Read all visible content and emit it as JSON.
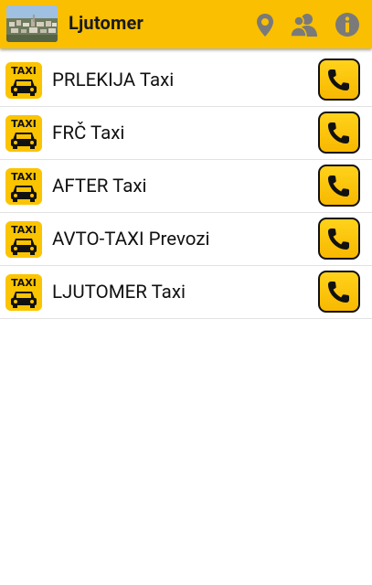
{
  "header": {
    "title": "Ljutomer",
    "thumbnail_icon": "town-photo",
    "actions": [
      {
        "icon": "location-pin-icon"
      },
      {
        "icon": "contacts-icon"
      },
      {
        "icon": "info-icon"
      }
    ],
    "accent_color": "#f9bf00"
  },
  "taxis": [
    {
      "name": "PRLEKIJA Taxi",
      "icon_text": "TAXI"
    },
    {
      "name": "FRČ Taxi",
      "icon_text": "TAXI"
    },
    {
      "name": "AFTER Taxi",
      "icon_text": "TAXI"
    },
    {
      "name": "AVTO-TAXI Prevozi",
      "icon_text": "TAXI"
    },
    {
      "name": "LJUTOMER Taxi",
      "icon_text": "TAXI"
    }
  ],
  "colors": {
    "header_bg": "#f9bf00",
    "call_button_bg": "#fbc400",
    "text": "#111111",
    "divider": "#e2e2e2",
    "icon_gray": "#7a7a7a"
  }
}
